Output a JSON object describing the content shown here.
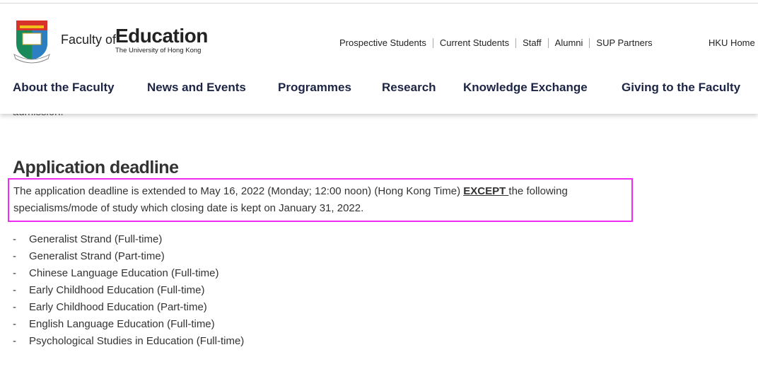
{
  "header": {
    "logo": {
      "prefix": "Faculty of",
      "name": "Education",
      "university": "The University of Hong Kong"
    },
    "utility_links": [
      "Prospective Students",
      "Current Students",
      "Staff",
      "Alumni",
      "SUP Partners"
    ],
    "home_link": "HKU Home",
    "nav": [
      "About the Faculty",
      "News and Events",
      "Programmes",
      "Research",
      "Knowledge Exchange",
      "Giving to the Faculty"
    ]
  },
  "main": {
    "clipped_text": "admission.",
    "heading": "Application deadline",
    "notice": {
      "before": "The application deadline is extended to May 16, 2022 (Monday; 12:00 noon) (Hong Kong Time) ",
      "emphasis": "EXCEPT ",
      "after": "the following specialisms/mode of study which closing date is kept on January 31, 2022."
    },
    "list": [
      "Generalist Strand (Full-time)",
      "Generalist Strand (Part-time)",
      "Chinese Language Education (Full-time)",
      "Early Childhood Education (Full-time)",
      "Early Childhood Education (Part-time)",
      "English Language Education (Full-time)",
      "Psychological Studies in Education (Full-time)"
    ]
  },
  "colors": {
    "nav": "#1d2545",
    "highlight_border": "#f02cf0"
  }
}
